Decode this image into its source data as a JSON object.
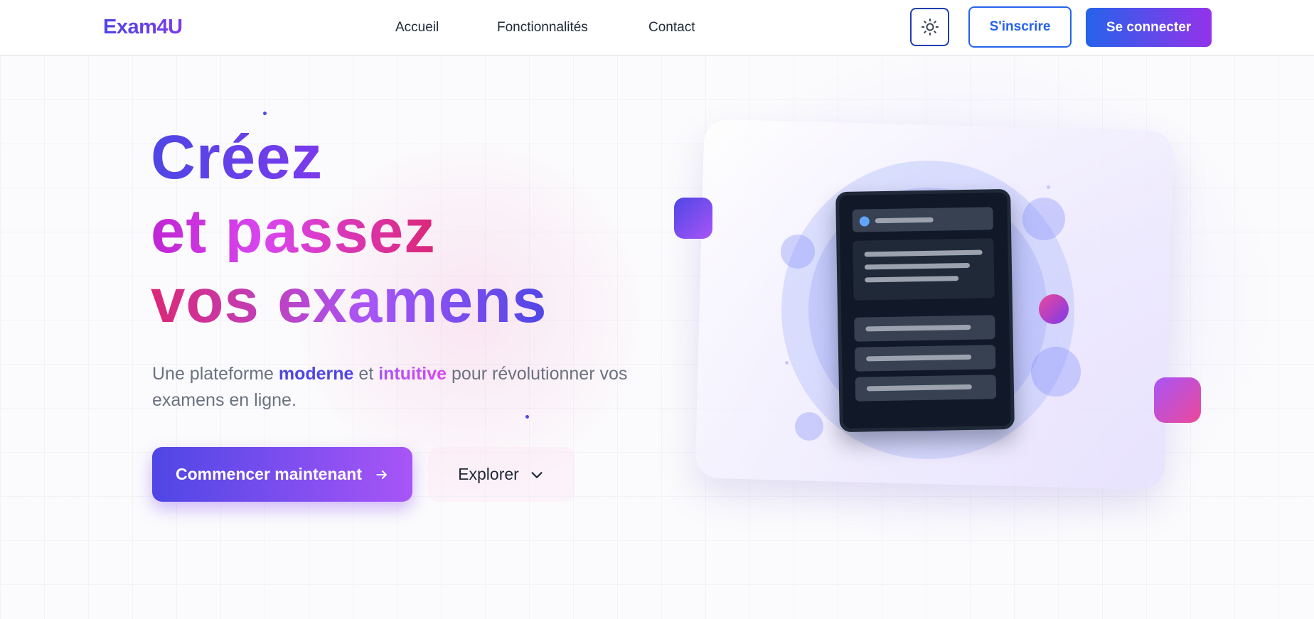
{
  "nav": {
    "logo": "Exam4U",
    "links": [
      "Accueil",
      "Fonctionnalités",
      "Contact"
    ],
    "theme_toggle_icon": "sun-icon",
    "register_label": "S'inscrire",
    "login_label": "Se connecter"
  },
  "hero": {
    "line1": "Créez",
    "line2": "et passez",
    "line3": "vos examens",
    "subtitle_part1": "Une plateforme ",
    "subtitle_highlight1": "moderne",
    "subtitle_part2": " et ",
    "subtitle_highlight2": "intuitive",
    "subtitle_part3": " pour révolutionner vos examens en ligne.",
    "cta_primary_label": "Commencer maintenant",
    "cta_primary_icon": "arrow-right-icon",
    "cta_secondary_label": "Explorer",
    "cta_secondary_icon": "chevron-down-icon"
  },
  "colors": {
    "brand_indigo": "#4f46e5",
    "brand_purple": "#a855f7",
    "brand_pink": "#db2777",
    "nav_blue": "#2563eb"
  }
}
